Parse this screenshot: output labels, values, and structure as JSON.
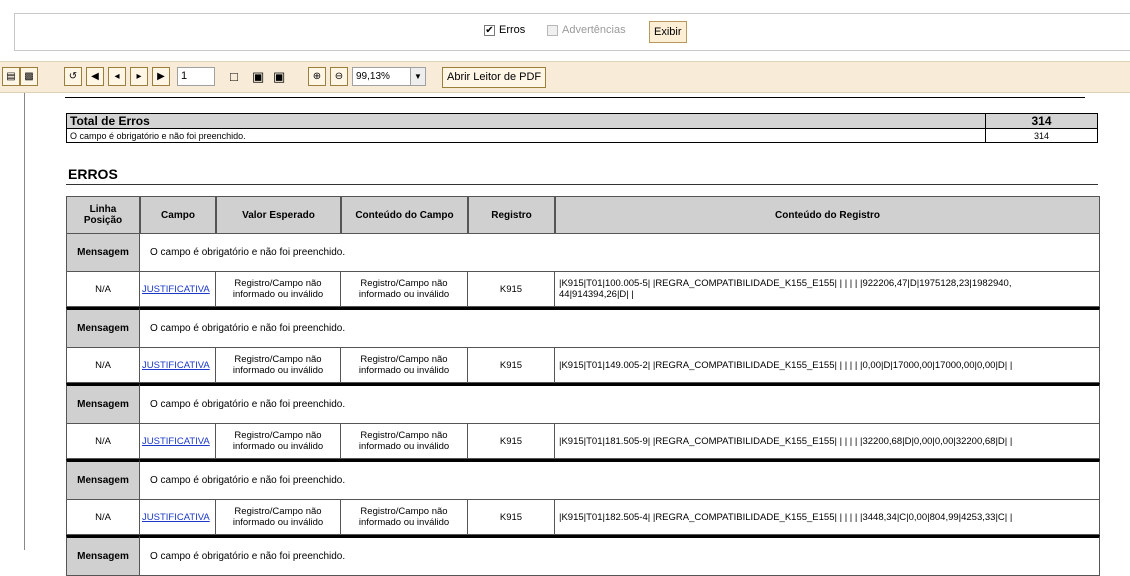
{
  "filter": {
    "erros_label": "Erros",
    "erros_checked": true,
    "advertencias_label": "Advertências",
    "advertencias_checked": false,
    "exibir_label": "Exibir"
  },
  "toolbar": {
    "page_number": "1",
    "zoom": "99,13%",
    "open_pdf_label": "Abrir Leitor de PDF"
  },
  "total": {
    "header_label": "Total de Erros",
    "header_count": "314",
    "row_text": "O campo é obrigatório e não foi preenchido.",
    "row_count": "314"
  },
  "section_title": "ERROS",
  "table": {
    "headers": {
      "linha_line1": "Linha",
      "linha_line2": "Posição",
      "campo": "Campo",
      "valor": "Valor Esperado",
      "conteudo_campo": "Conteúdo do Campo",
      "registro": "Registro",
      "conteudo_registro": "Conteúdo do Registro"
    },
    "entries": [
      {
        "msg_label": "Mensagem",
        "msg_text": "O campo é obrigatório e não foi preenchido.",
        "linha": "N/A",
        "campo": "JUSTIFICATIVA",
        "valor_l1": "Registro/Campo não",
        "valor_l2": "informado ou inválido",
        "conteudo_l1": "Registro/Campo não",
        "conteudo_l2": "informado ou inválido",
        "registro": "K915",
        "conteudo_registro_l1": "|K915|T01|100.005-5| |REGRA_COMPATIBILIDADE_K155_E155| | | | | |922206,47|D|1975128,23|1982940,",
        "conteudo_registro_l2": "44|914394,26|D| |"
      },
      {
        "msg_label": "Mensagem",
        "msg_text": "O campo é obrigatório e não foi preenchido.",
        "linha": "N/A",
        "campo": "JUSTIFICATIVA",
        "valor_l1": "Registro/Campo não",
        "valor_l2": "informado ou inválido",
        "conteudo_l1": "Registro/Campo não",
        "conteudo_l2": "informado ou inválido",
        "registro": "K915",
        "conteudo_registro_l1": "|K915|T01|149.005-2| |REGRA_COMPATIBILIDADE_K155_E155| | | | | |0,00|D|17000,00|17000,00|0,00|D| |",
        "conteudo_registro_l2": ""
      },
      {
        "msg_label": "Mensagem",
        "msg_text": "O campo é obrigatório e não foi preenchido.",
        "linha": "N/A",
        "campo": "JUSTIFICATIVA",
        "valor_l1": "Registro/Campo não",
        "valor_l2": "informado ou inválido",
        "conteudo_l1": "Registro/Campo não",
        "conteudo_l2": "informado ou inválido",
        "registro": "K915",
        "conteudo_registro_l1": "|K915|T01|181.505-9| |REGRA_COMPATIBILIDADE_K155_E155| | | | | |32200,68|D|0,00|0,00|32200,68|D| |",
        "conteudo_registro_l2": ""
      },
      {
        "msg_label": "Mensagem",
        "msg_text": "O campo é obrigatório e não foi preenchido.",
        "linha": "N/A",
        "campo": "JUSTIFICATIVA",
        "valor_l1": "Registro/Campo não",
        "valor_l2": "informado ou inválido",
        "conteudo_l1": "Registro/Campo não",
        "conteudo_l2": "informado ou inválido",
        "registro": "K915",
        "conteudo_registro_l1": "|K915|T01|182.505-4| |REGRA_COMPATIBILIDADE_K155_E155| | | | | |3448,34|C|0,00|804,99|4253,33|C| |",
        "conteudo_registro_l2": ""
      }
    ],
    "partial_msg_label": "Mensagem",
    "partial_msg_text": "O campo é obrigatório e não foi preenchido."
  }
}
